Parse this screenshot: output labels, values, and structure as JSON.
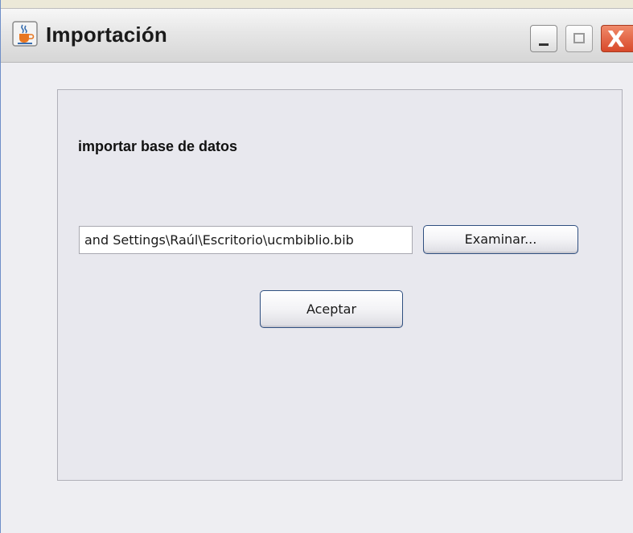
{
  "window": {
    "title": "Importación",
    "icon": "java-coffee-cup-icon",
    "controls": {
      "minimize": "minimize-icon",
      "maximize": "maximize-icon",
      "close": "X"
    }
  },
  "form": {
    "heading": "importar base de datos",
    "path_value": "and Settings\\Raúl\\Escritorio\\ucmbiblio.bib",
    "browse_label": "Examinar...",
    "accept_label": "Aceptar"
  },
  "colors": {
    "close_button": "#d8492a",
    "button_border": "#2f4f80",
    "content_bg": "#eeeef2"
  }
}
